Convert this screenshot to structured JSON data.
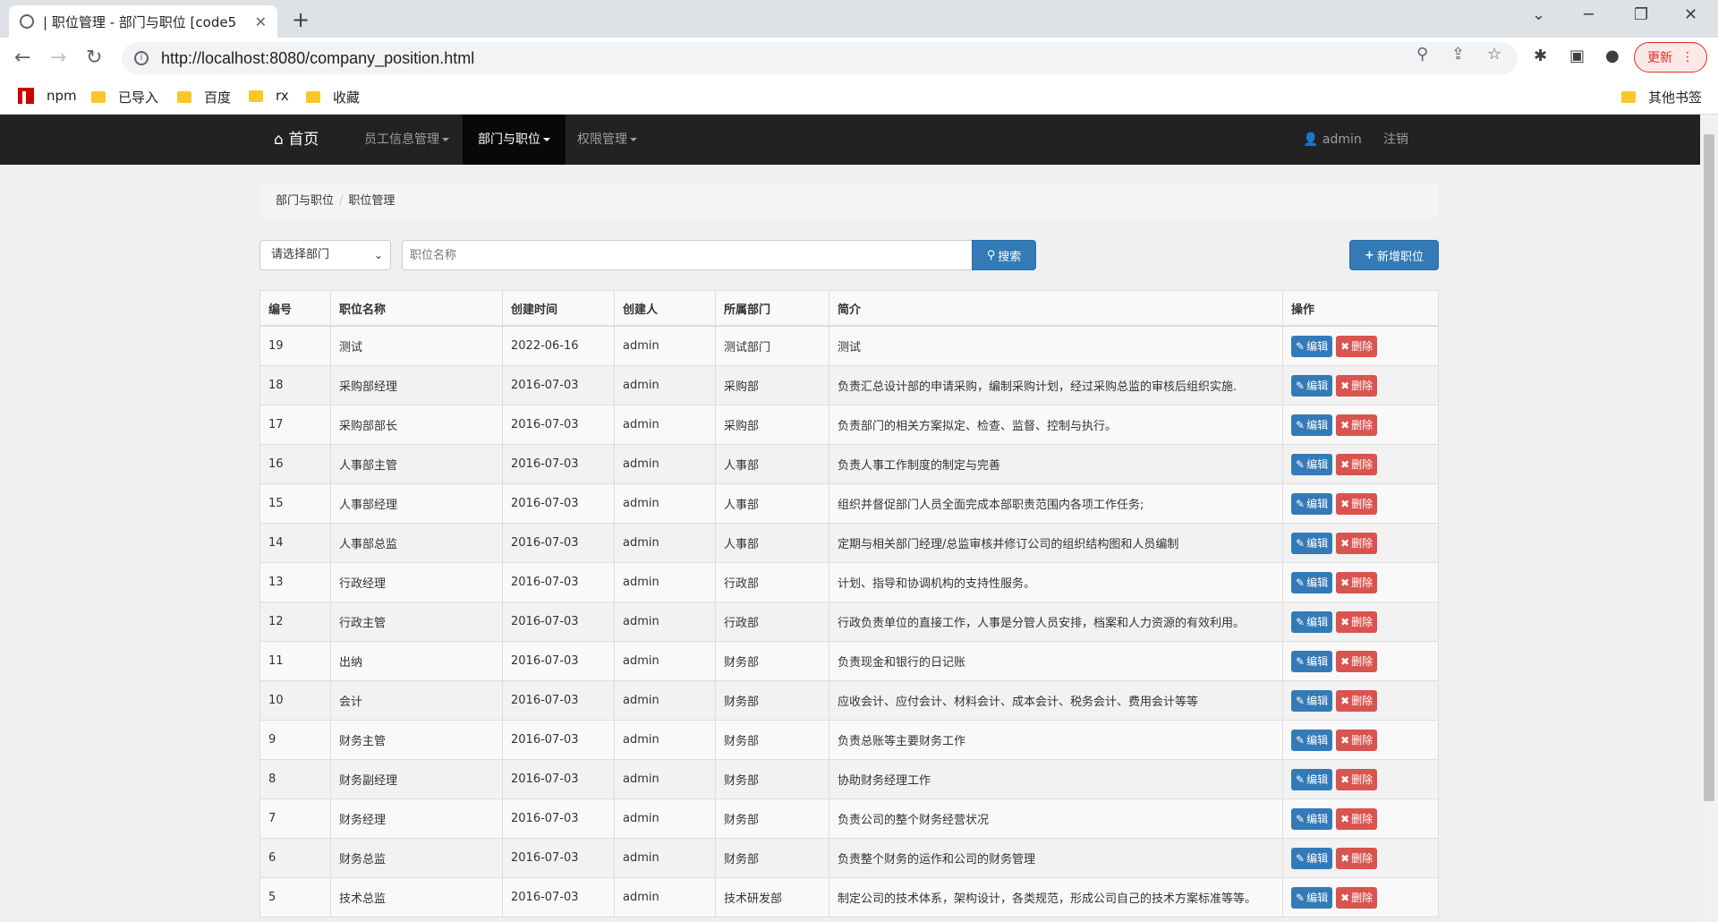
{
  "browser": {
    "tab_title": "| 职位管理 - 部门与职位 [code5",
    "url": "http://localhost:8080/company_position.html",
    "update_label": "更新",
    "bookmarks": [
      "npm",
      "已导入",
      "百度",
      "rx",
      "收藏"
    ],
    "other_bookmarks": "其他书签"
  },
  "navbar": {
    "home": "首页",
    "menus": [
      "员工信息管理",
      "部门与职位",
      "权限管理"
    ],
    "user": "admin",
    "logout": "注销"
  },
  "breadcrumb": {
    "parent": "部门与职位",
    "current": "职位管理"
  },
  "filters": {
    "department_select": "请选择部门",
    "position_placeholder": "职位名称",
    "search_label": "搜索",
    "add_label": "新增职位"
  },
  "table": {
    "headers": [
      "编号",
      "职位名称",
      "创建时间",
      "创建人",
      "所属部门",
      "简介",
      "操作"
    ],
    "edit_label": "编辑",
    "delete_label": "删除",
    "rows": [
      [
        "19",
        "测试",
        "2022-06-16",
        "admin",
        "测试部门",
        "测试"
      ],
      [
        "18",
        "采购部经理",
        "2016-07-03",
        "admin",
        "采购部",
        "负责汇总设计部的申请采购，编制采购计划，经过采购总监的审核后组织实施."
      ],
      [
        "17",
        "采购部部长",
        "2016-07-03",
        "admin",
        "采购部",
        "负责部门的相关方案拟定、检查、监督、控制与执行。"
      ],
      [
        "16",
        "人事部主管",
        "2016-07-03",
        "admin",
        "人事部",
        "负责人事工作制度的制定与完善"
      ],
      [
        "15",
        "人事部经理",
        "2016-07-03",
        "admin",
        "人事部",
        "组织并督促部门人员全面完成本部职责范围内各项工作任务;"
      ],
      [
        "14",
        "人事部总监",
        "2016-07-03",
        "admin",
        "人事部",
        "定期与相关部门经理/总监审核并修订公司的组织结构图和人员编制"
      ],
      [
        "13",
        "行政经理",
        "2016-07-03",
        "admin",
        "行政部",
        "计划、指导和协调机构的支持性服务。"
      ],
      [
        "12",
        "行政主管",
        "2016-07-03",
        "admin",
        "行政部",
        "行政负责单位的直接工作，人事是分管人员安排，档案和人力资源的有效利用。"
      ],
      [
        "11",
        "出纳",
        "2016-07-03",
        "admin",
        "财务部",
        "负责现金和银行的日记账"
      ],
      [
        "10",
        "会计",
        "2016-07-03",
        "admin",
        "财务部",
        "应收会计、应付会计、材料会计、成本会计、税务会计、费用会计等等"
      ],
      [
        "9",
        "财务主管",
        "2016-07-03",
        "admin",
        "财务部",
        "负责总账等主要财务工作"
      ],
      [
        "8",
        "财务副经理",
        "2016-07-03",
        "admin",
        "财务部",
        "协助财务经理工作"
      ],
      [
        "7",
        "财务经理",
        "2016-07-03",
        "admin",
        "财务部",
        "负责公司的整个财务经营状况"
      ],
      [
        "6",
        "财务总监",
        "2016-07-03",
        "admin",
        "财务部",
        "负责整个财务的运作和公司的财务管理"
      ],
      [
        "5",
        "技术总监",
        "2016-07-03",
        "admin",
        "技术研发部",
        "制定公司的技术体系，架构设计，各类规范，形成公司自己的技术方案标准等等。"
      ]
    ]
  }
}
